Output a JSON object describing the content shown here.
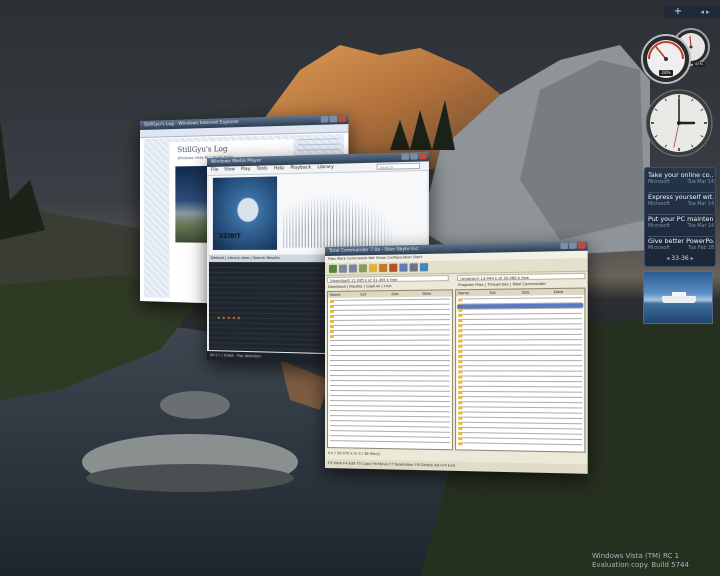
{
  "windows": {
    "browser": {
      "title": "StillGyu's Log - Windows Internet Explorer",
      "blog_title": "StillGyu's Log",
      "blog_subtitle": "Windows Vista RC1 Build 5744"
    },
    "media_player": {
      "title": "Windows Media Player",
      "menu": [
        "File",
        "View",
        "Play",
        "Tools",
        "Help"
      ],
      "menu_extra": [
        "Playback",
        "Library"
      ],
      "search_placeholder": "Search",
      "album_text": "XZIBIT",
      "tabs_text": "Default  |  Library view  |  Search Results",
      "rating": "★★★★★",
      "status_text": "00:17  |  Xzibit - Pay Attention"
    },
    "total_commander": {
      "title": "Total Commander 7.0a - Stan Sbyte Inc.",
      "menu_text": "Files  Mark  Commands  Net  Show  Configuration  Start",
      "left_drive": "[download] 21,085 k of 31,495 k free",
      "right_drive": "[program] 13,444 k of 30,980 k free",
      "left_tabs": "Download  |  Filezilla  |  Capture  |  Line",
      "right_tabs": "Program Files  |  Thread bas  |  Total Commander",
      "columns": [
        "Name",
        "Ext",
        "Size",
        "Date"
      ],
      "status_text": "0 k / 39,575 k in 0 / 36 file(s)",
      "cmdbar": "F3 View  F4 Edit  F5 Copy  F6 Move  F7 NewFolder  F8 Delete  Alt+F4 Exit"
    }
  },
  "sidebar": {
    "add_label": "+",
    "nav_label": "◂ ▸",
    "cpu_percent": "28%",
    "mem_percent": "47%",
    "clock": {
      "hour": 3,
      "minute": 0,
      "second": 32
    },
    "feeds": [
      {
        "title": "Take your online co...",
        "source": "Microsoft",
        "date": "Tue Mar 14"
      },
      {
        "title": "Express yourself wit...",
        "source": "Microsoft",
        "date": "Tue Mar 14"
      },
      {
        "title": "Put your PC mainten...",
        "source": "Microsoft",
        "date": "Tue Mar 14"
      },
      {
        "title": "Give better PowerPo...",
        "source": "Microsoft",
        "date": "Tue Feb 28"
      }
    ],
    "feed_range": "33-36",
    "feed_prev": "◂",
    "feed_next": "▸"
  },
  "watermark": {
    "line1": "Windows Vista (TM) RC 1",
    "line2": "Evaluation copy. Build 5744"
  }
}
